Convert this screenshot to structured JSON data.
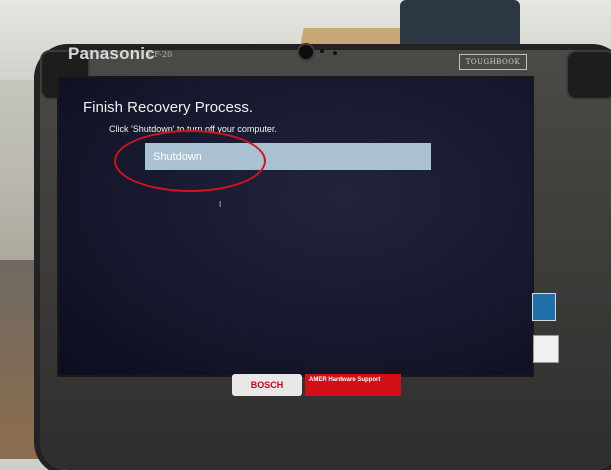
{
  "device": {
    "brand": "Panasonic",
    "model": "CF-20",
    "badge": "TOUGHBOOK"
  },
  "screen": {
    "title": "Finish Recovery Process.",
    "instruction": "Click 'Shutdown' to turn off your computer.",
    "shutdown_label": "Shutdown"
  },
  "stickers": {
    "bosch": "BOSCH",
    "support_title": "AMER Hardware Support"
  },
  "colors": {
    "button_bg": "#a9c1d2",
    "screen_bg": "#15172c",
    "annotation": "#d3141c"
  }
}
